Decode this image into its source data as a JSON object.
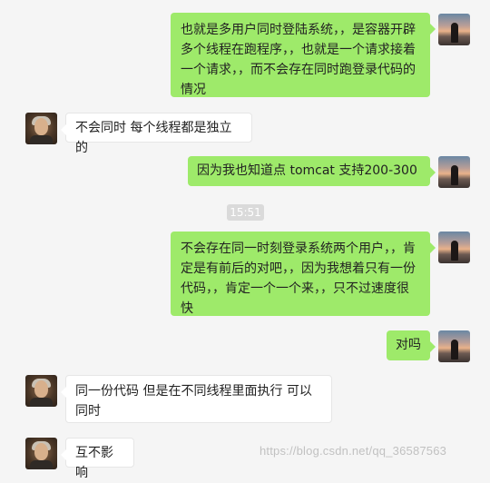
{
  "messages": [
    {
      "from": "self",
      "text": "也就是多用户同时登陆系统，，是容器开辟多个线程在跑程序，，也就是一个请求接着一个请求，，而不会存在同时跑登录代码的情况"
    },
    {
      "from": "other",
      "text": "不会同时 每个线程都是独立的"
    },
    {
      "from": "self",
      "text": "因为我也知道点 tomcat 支持200-300"
    },
    {
      "from": "self",
      "text": "不会存在同一时刻登录系统两个用户，，肯定是有前后的对吧，，因为我想着只有一份代码，，肯定一个一个来，，只不过速度很快"
    },
    {
      "from": "self",
      "text": "对吗"
    },
    {
      "from": "other",
      "text": "同一份代码 但是在不同线程里面执行 可以同时"
    },
    {
      "from": "other",
      "text": "互不影响"
    }
  ],
  "timestamp": "15:51",
  "watermark": "https://blog.csdn.net/qq_36587563"
}
